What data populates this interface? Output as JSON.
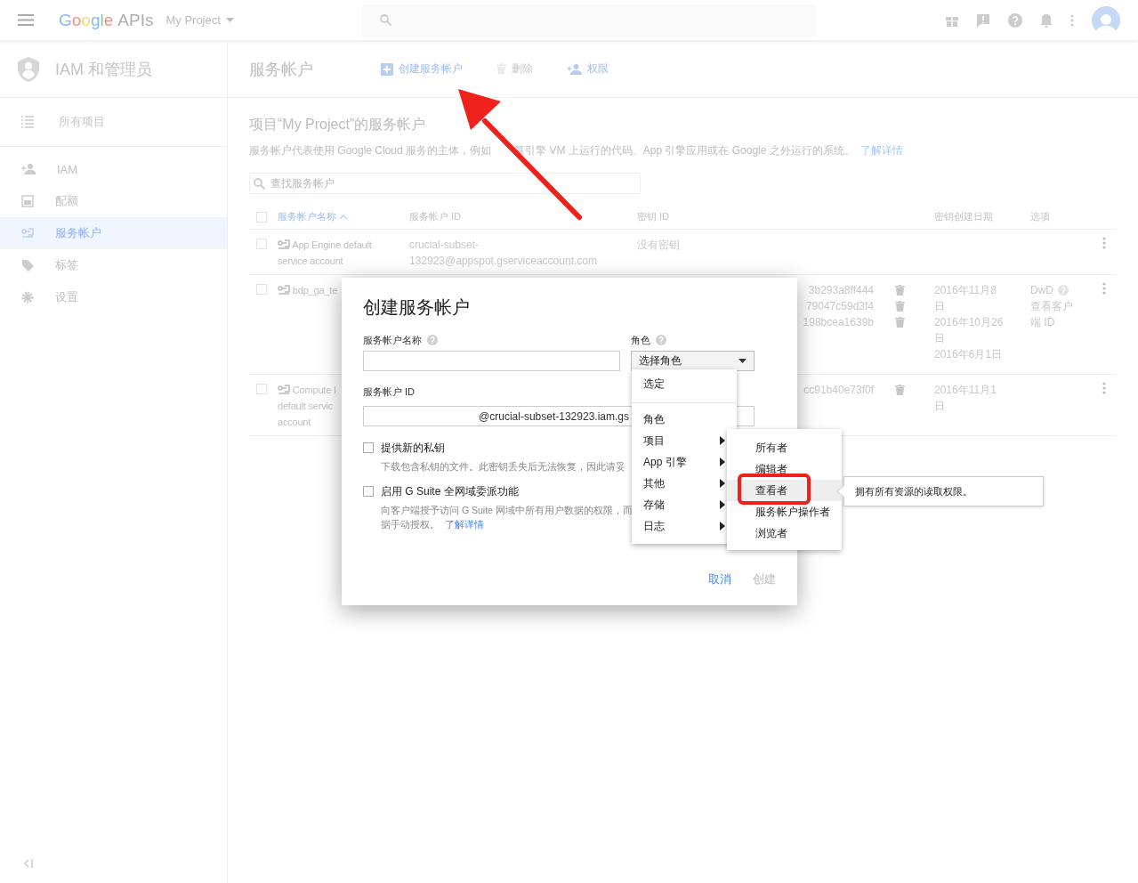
{
  "topbar": {
    "logo_brand": "Google",
    "logo_suffix": "APIs",
    "project": "My Project"
  },
  "sidebar": {
    "title": "IAM 和管理员",
    "all_projects": "所有项目",
    "items": [
      {
        "label": "IAM",
        "selected": false
      },
      {
        "label": "配额",
        "selected": false
      },
      {
        "label": "服务帐户",
        "selected": true
      },
      {
        "label": "标签",
        "selected": false
      },
      {
        "label": "设置",
        "selected": false
      }
    ]
  },
  "header": {
    "title": "服务帐户",
    "actions": [
      {
        "label": "创建服务帐户",
        "disabled": false
      },
      {
        "label": "删除",
        "disabled": true
      },
      {
        "label": "权限",
        "disabled": false
      }
    ]
  },
  "page": {
    "heading": "项目“My Project”的服务帐户",
    "description": "服务帐户代表使用 Google Cloud 服务的主体，例如",
    "description_2": "算引擎 VM 上运行的代码、App 引擎应用或在 Google 之外运行的系统。",
    "link": "了解详情",
    "search_placeholder": "查找服务帐户"
  },
  "table": {
    "select_all_checked": false,
    "columns": [
      {
        "label": "服务帐户名称",
        "sorted": true
      },
      {
        "label": "服务帐户 ID",
        "sorted": false
      },
      {
        "label": "密钥 ID",
        "sorted": false
      },
      {
        "label": "密钥创建日期",
        "sorted": false
      },
      {
        "label": "选项",
        "sorted": false
      }
    ],
    "rows": [
      {
        "checked": false,
        "name": [
          "App Engine default",
          "service account"
        ],
        "id": [
          "crucial-subset-",
          "132923@appspot.gserviceaccount.com"
        ],
        "key_note": "没有密钥",
        "keys": [],
        "dates": [],
        "options": null
      },
      {
        "checked": false,
        "name": [
          "bdp_ga_te"
        ],
        "id": [],
        "keys": [
          "3b293a8ff444",
          "79047c59d3f4",
          "198bcea1639b"
        ],
        "dates": [
          [
            "2016年11月8",
            "日"
          ],
          [
            "2016年10月26",
            "日"
          ],
          [
            "2016年6月1日"
          ]
        ],
        "options": {
          "label": "DwD",
          "link": [
            "查看客户",
            "端 ID"
          ]
        }
      },
      {
        "checked": false,
        "name": [
          "Compute I",
          "default servic",
          "account"
        ],
        "id": [],
        "keys": [
          "cc91b40e73f0f"
        ],
        "dates": [
          [
            "2016年11月1",
            "日"
          ]
        ],
        "options": null
      }
    ]
  },
  "dialog": {
    "title": "创建服务帐户",
    "name_label": "服务帐户名称",
    "role_label": "角色",
    "role_select": "选择角色",
    "id_label": "服务帐户 ID",
    "id_value": "@crucial-subset-132923.iam.gs",
    "options": [
      {
        "label": "提供新的私钥",
        "checked": false,
        "description": "下载包含私钥的文件。此密钥丢失后无法恢复，因此请妥"
      },
      {
        "label": "启用 G Suite 全网域委派功能",
        "checked": false,
        "description": "向客户端授予访问 G Suite 网域中所有用户数据的权限，而",
        "description_2": "据手动授权。",
        "link": "了解详情"
      }
    ],
    "cancel": "取消",
    "create": "创建",
    "create_disabled": true
  },
  "role_menu": {
    "selected_label": "选定",
    "section": "角色",
    "groups": [
      "项目",
      "App 引擎",
      "其他",
      "存储",
      "日志"
    ]
  },
  "role_submenu": {
    "items": [
      {
        "label": "所有者",
        "selected": false
      },
      {
        "label": "编辑者",
        "selected": false
      },
      {
        "label": "查看者",
        "selected": true
      },
      {
        "label": "服务帐户操作者",
        "selected": false
      },
      {
        "label": "浏览者",
        "selected": false
      }
    ]
  },
  "tooltip": "拥有所有资源的读取权限。"
}
